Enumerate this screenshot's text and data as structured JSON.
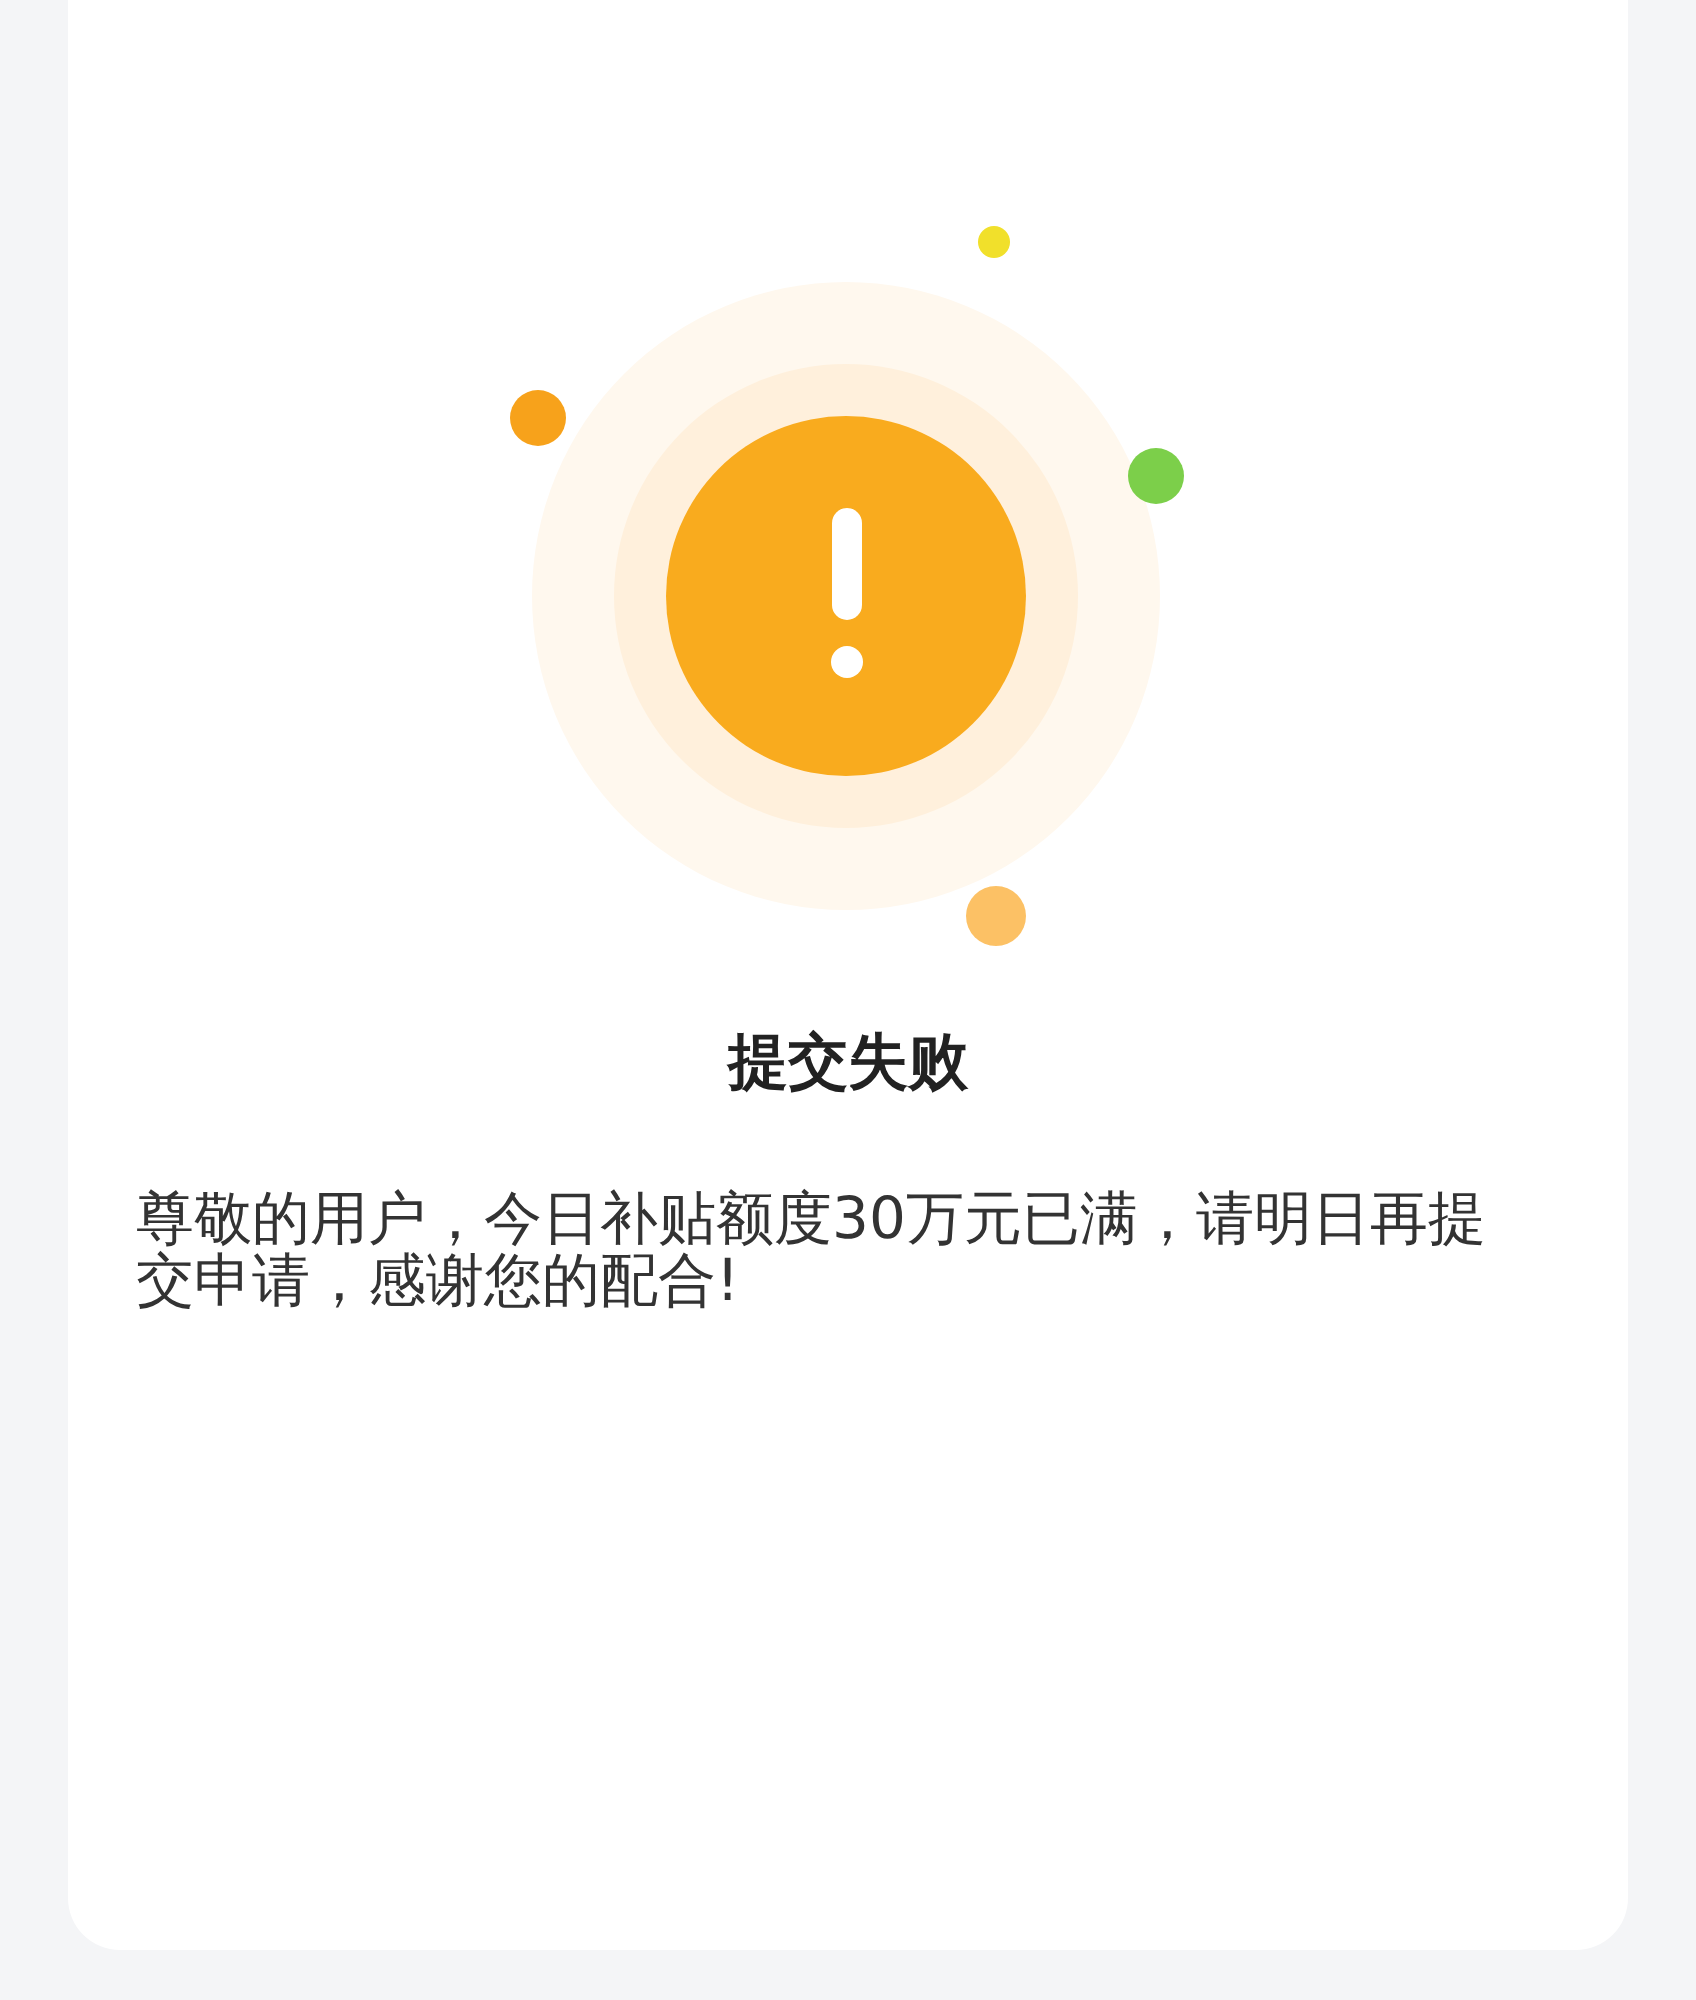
{
  "dialog": {
    "title": "提交失败",
    "message": "尊敬的用户，今日补贴额度30万元已满，请明日再提交申请，感谢您的配合!"
  }
}
